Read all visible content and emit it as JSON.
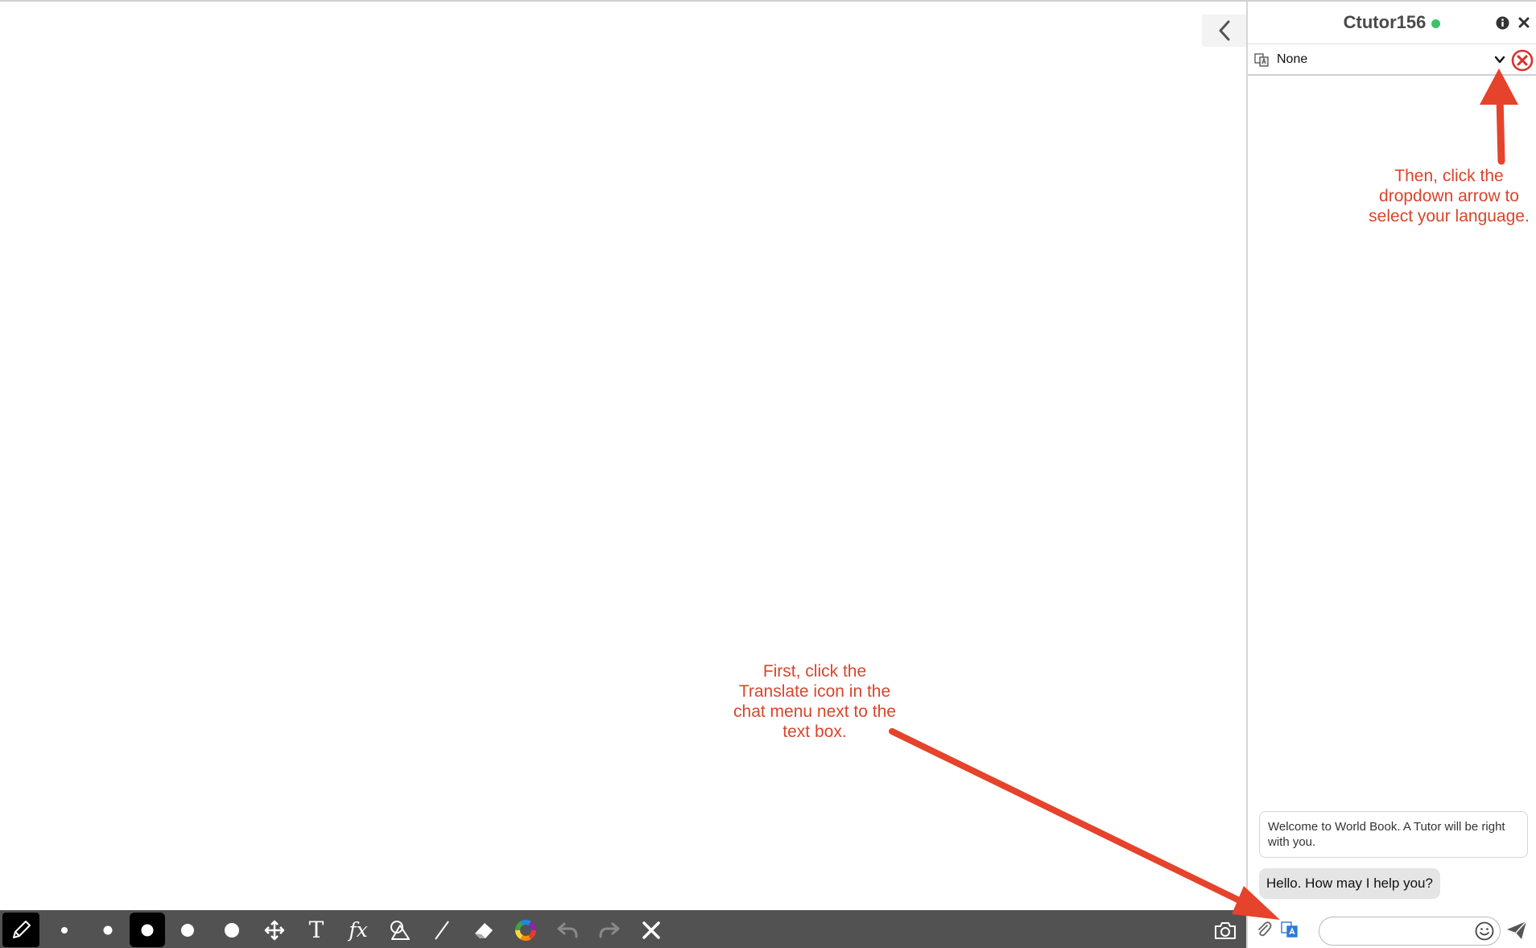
{
  "chat": {
    "title": "Ctutor156",
    "language": {
      "selected": "None"
    },
    "messages": {
      "system": "Welcome to World Book. A Tutor will be right with you.",
      "tutor": "Hello. How may I help you?"
    },
    "input": {
      "value": "",
      "placeholder": ""
    }
  },
  "toolbar": {
    "tools": [
      "pencil-icon",
      "size-1",
      "size-2",
      "size-3",
      "size-4",
      "size-5",
      "move-icon",
      "text-icon",
      "formula-icon",
      "shapes-icon",
      "line-icon",
      "eraser-icon",
      "color-wheel-icon",
      "undo-icon",
      "redo-icon",
      "clear-icon",
      "camera-icon"
    ],
    "formula_label": "fx",
    "text_label": "T"
  },
  "annotations": {
    "first": "First, click the Translate icon in the chat menu next to the text box.",
    "then": "Then, click the dropdown arrow to select your language."
  },
  "colors": {
    "toolbar_bg": "#525252",
    "annotation": "#d9452b",
    "online": "#3cc26a",
    "close_red": "#d9302b"
  }
}
